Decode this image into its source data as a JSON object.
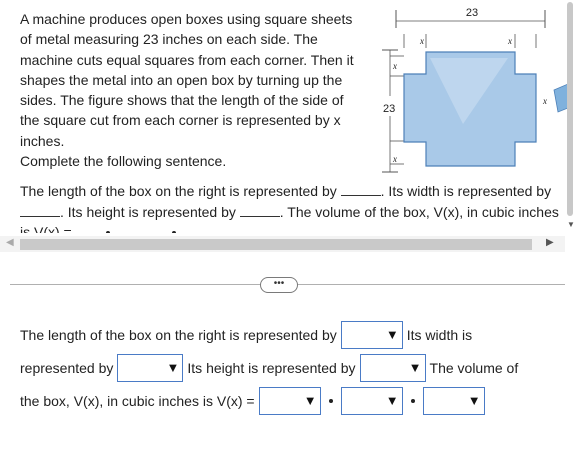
{
  "problem": {
    "text": "A machine produces open boxes using square sheets of metal measuring 23 inches on each side. The machine cuts equal squares from each corner. Then it shapes the metal into an open box by turning up the sides. The figure shows that the length of the side of the square cut from each corner is represented by x inches.",
    "instruction": "Complete the following sentence."
  },
  "figure": {
    "dimension_top": "23",
    "dimension_left": "23",
    "var_label": "x"
  },
  "sentence_preview": {
    "part1": "The length of the box on the right is represented by",
    "part2": ". Its width is represented by",
    "part3": ". Its height is represented by",
    "part4": ". The volume of the box, V(x), in cubic inches is V(x) ="
  },
  "more_button": "•••",
  "answer": {
    "line1_a": "The length of the box on the right is represented by",
    "line1_b": "Its width is",
    "line2_a": "represented by",
    "line2_b": "Its height is represented by",
    "line2_c": "The volume of",
    "line3_a": "the box, V(x), in cubic inches is V(x) ="
  },
  "colors": {
    "accent": "#4a7bc6",
    "sheet": "#a9c9e8",
    "sheet_edge": "#4d80b8"
  }
}
